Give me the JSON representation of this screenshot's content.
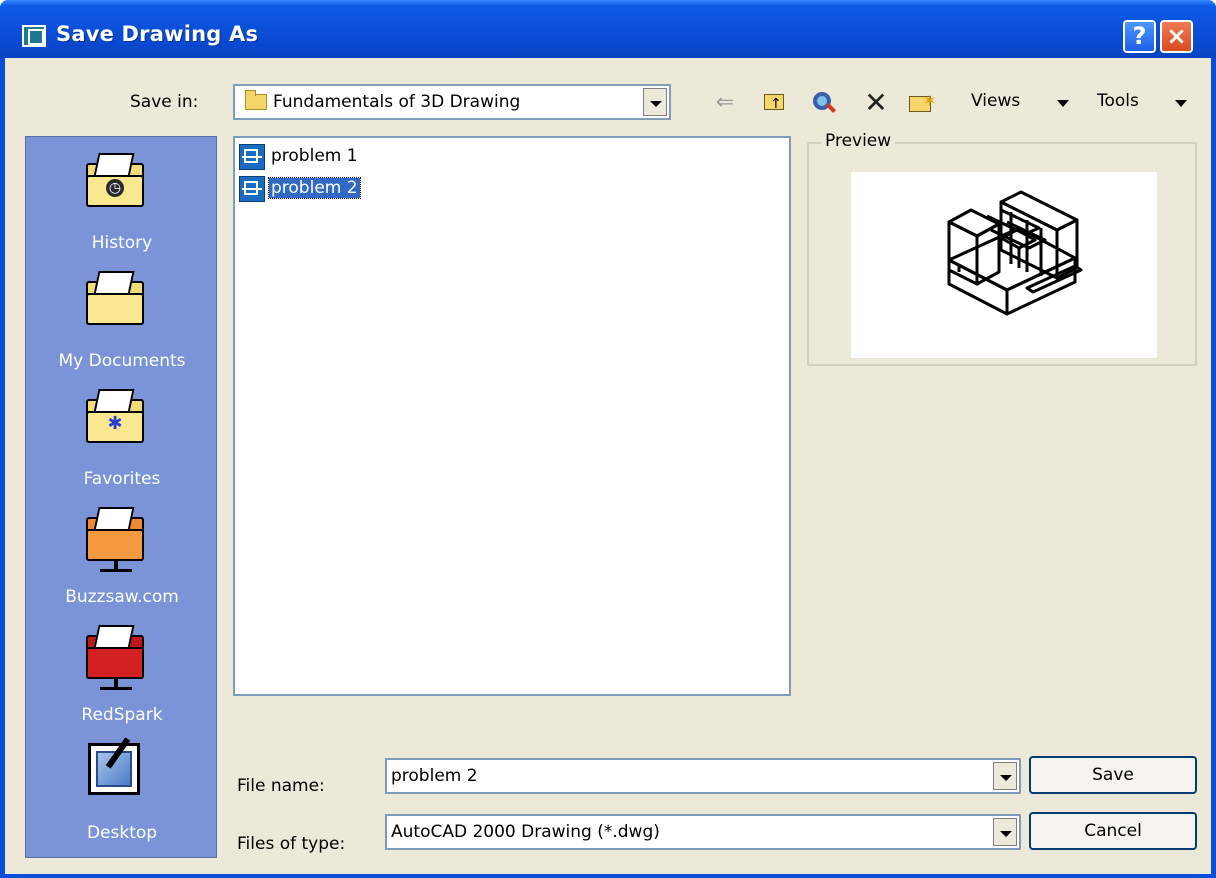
{
  "window": {
    "title": "Save Drawing As"
  },
  "titlebar": {
    "help_label": "?",
    "close_label": "×"
  },
  "toolbar": {
    "save_in_label": "Save in:",
    "save_in_value": "Fundamentals of 3D Drawing",
    "views_label": "Views",
    "tools_label": "Tools",
    "icons": [
      "back-icon",
      "up-one-level-icon",
      "search-web-icon",
      "delete-icon",
      "new-folder-icon"
    ]
  },
  "places": [
    {
      "label": "History",
      "icon": "history-folder-icon"
    },
    {
      "label": "My Documents",
      "icon": "my-documents-folder-icon"
    },
    {
      "label": "Favorites",
      "icon": "favorites-folder-icon"
    },
    {
      "label": "Buzzsaw.com",
      "icon": "buzzsaw-network-folder-icon"
    },
    {
      "label": "RedSpark",
      "icon": "redspark-network-folder-icon"
    },
    {
      "label": "Desktop",
      "icon": "desktop-icon"
    }
  ],
  "files": [
    {
      "name": "problem 1",
      "selected": false
    },
    {
      "name": "problem 2",
      "selected": true
    }
  ],
  "preview": {
    "label": "Preview"
  },
  "form": {
    "file_name_label": "File name:",
    "file_name_value": "problem 2",
    "file_type_label": "Files of type:",
    "file_type_value": "AutoCAD 2000 Drawing (*.dwg)"
  },
  "buttons": {
    "save": "Save",
    "cancel": "Cancel"
  },
  "colors": {
    "title_bar": "#0a4cd6",
    "places_bar": "#7b94d8",
    "selection": "#316ac5",
    "dialog_bg": "#ece9d8"
  }
}
